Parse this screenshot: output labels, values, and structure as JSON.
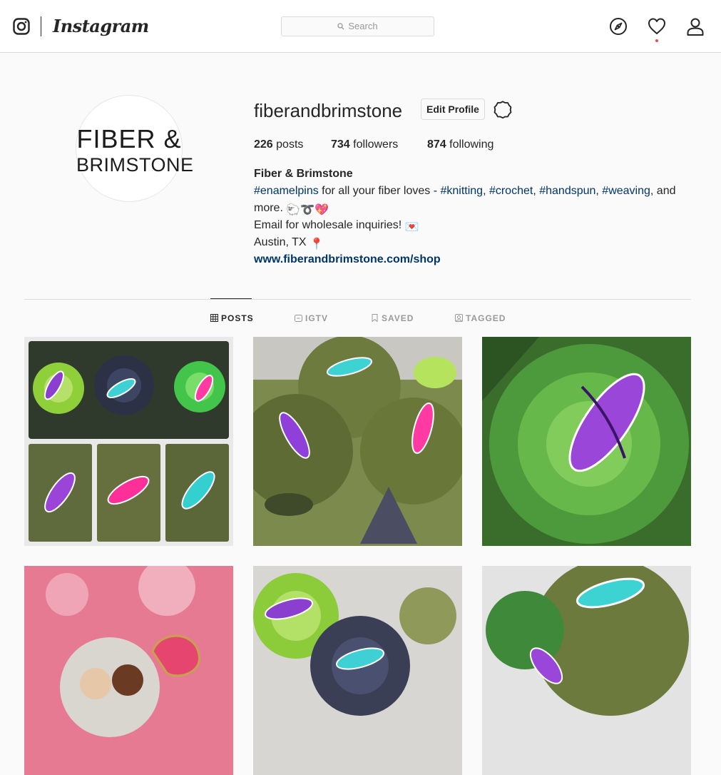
{
  "nav": {
    "wordmark": "Instagram",
    "search_placeholder": "Search",
    "icons": [
      "instagram-glyph-icon",
      "compass-icon",
      "heart-icon",
      "user-icon"
    ]
  },
  "profile": {
    "avatar_line1": "FIBER &",
    "avatar_line2": "BRIMSTONE",
    "username": "fiberandbrimstone",
    "edit_label": "Edit Profile",
    "stats": {
      "posts_count": "226",
      "posts_label": " posts",
      "followers_count": "734",
      "followers_label": " followers",
      "following_count": "874",
      "following_label": " following"
    },
    "full_name": "Fiber & Brimstone",
    "bio": {
      "tag_enamelpins": "#enamelpins",
      "text_1": " for all your fiber loves - ",
      "tag_knitting": "#knitting",
      "sep_1": ", ",
      "tag_crochet": "#crochet",
      "sep_2": ", ",
      "tag_handspun": "#handspun",
      "sep_3": ", ",
      "tag_weaving": "#weaving",
      "text_2": ", and",
      "text_3": "more. ",
      "emoji_line2": "🐑➰💖",
      "email_text": "Email for wholesale inquiries! ",
      "email_emoji": "💌",
      "location_text": "Austin, TX ",
      "location_emoji": "📍"
    },
    "website": "www.fiberandbrimstone.com/shop"
  },
  "tabs": [
    {
      "label": "POSTS",
      "active": true
    },
    {
      "label": "IGTV",
      "active": false
    },
    {
      "label": "SAVED",
      "active": false
    },
    {
      "label": "TAGGED",
      "active": false
    }
  ],
  "colors": {
    "link": "#003569",
    "border": "#dbdbdb",
    "muted": "#999999",
    "text": "#262626",
    "notification": "#ed4956"
  }
}
